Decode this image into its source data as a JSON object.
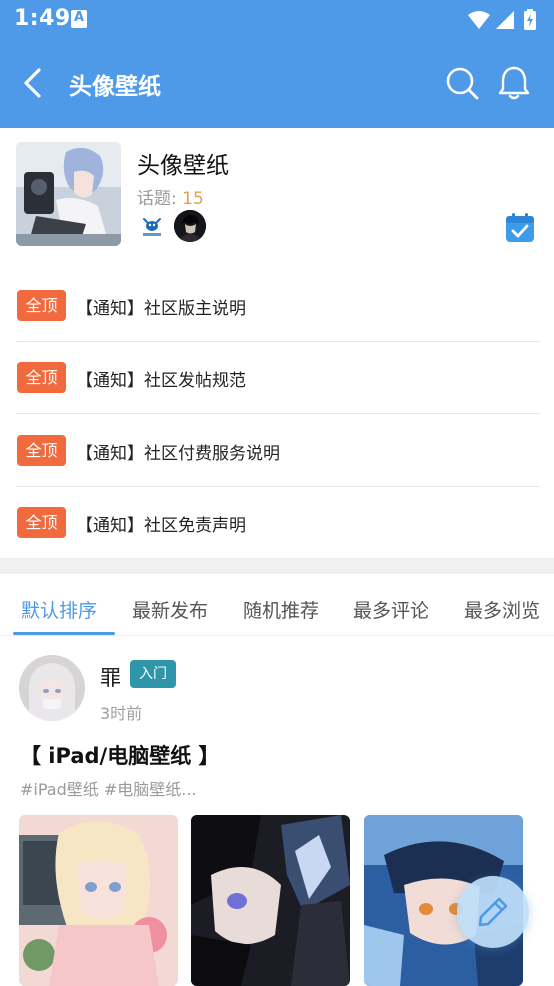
{
  "status_bar": {
    "time": "1:49",
    "notif_glyph": "A"
  },
  "header": {
    "title": "头像壁纸"
  },
  "forum": {
    "name": "头像壁纸",
    "topics_label": "话题:",
    "topics_count": "15"
  },
  "notices": [
    {
      "badge": "全顶",
      "text": "【通知】社区版主说明"
    },
    {
      "badge": "全顶",
      "text": "【通知】社区发帖规范"
    },
    {
      "badge": "全顶",
      "text": "【通知】社区付费服务说明"
    },
    {
      "badge": "全顶",
      "text": "【通知】社区免责声明"
    }
  ],
  "tabs": [
    "默认排序",
    "最新发布",
    "随机推荐",
    "最多评论",
    "最多浏览"
  ],
  "active_tab": "默认排序",
  "post": {
    "author": "罪",
    "level": "入门",
    "time": "3时前",
    "title": "【 iPad/电脑壁纸 】",
    "tags": "#iPad壁纸 #电脑壁纸..."
  },
  "colors": {
    "primary": "#4f9ae8",
    "pin_badge": "#f06a3d",
    "level_badge": "#2e96a8",
    "topics_count": "#e2a14f"
  },
  "icons": [
    "back-icon",
    "search-icon",
    "bell-icon",
    "calendar-check-icon",
    "edit-pencil-icon",
    "wifi-icon",
    "signal-icon",
    "battery-icon"
  ]
}
